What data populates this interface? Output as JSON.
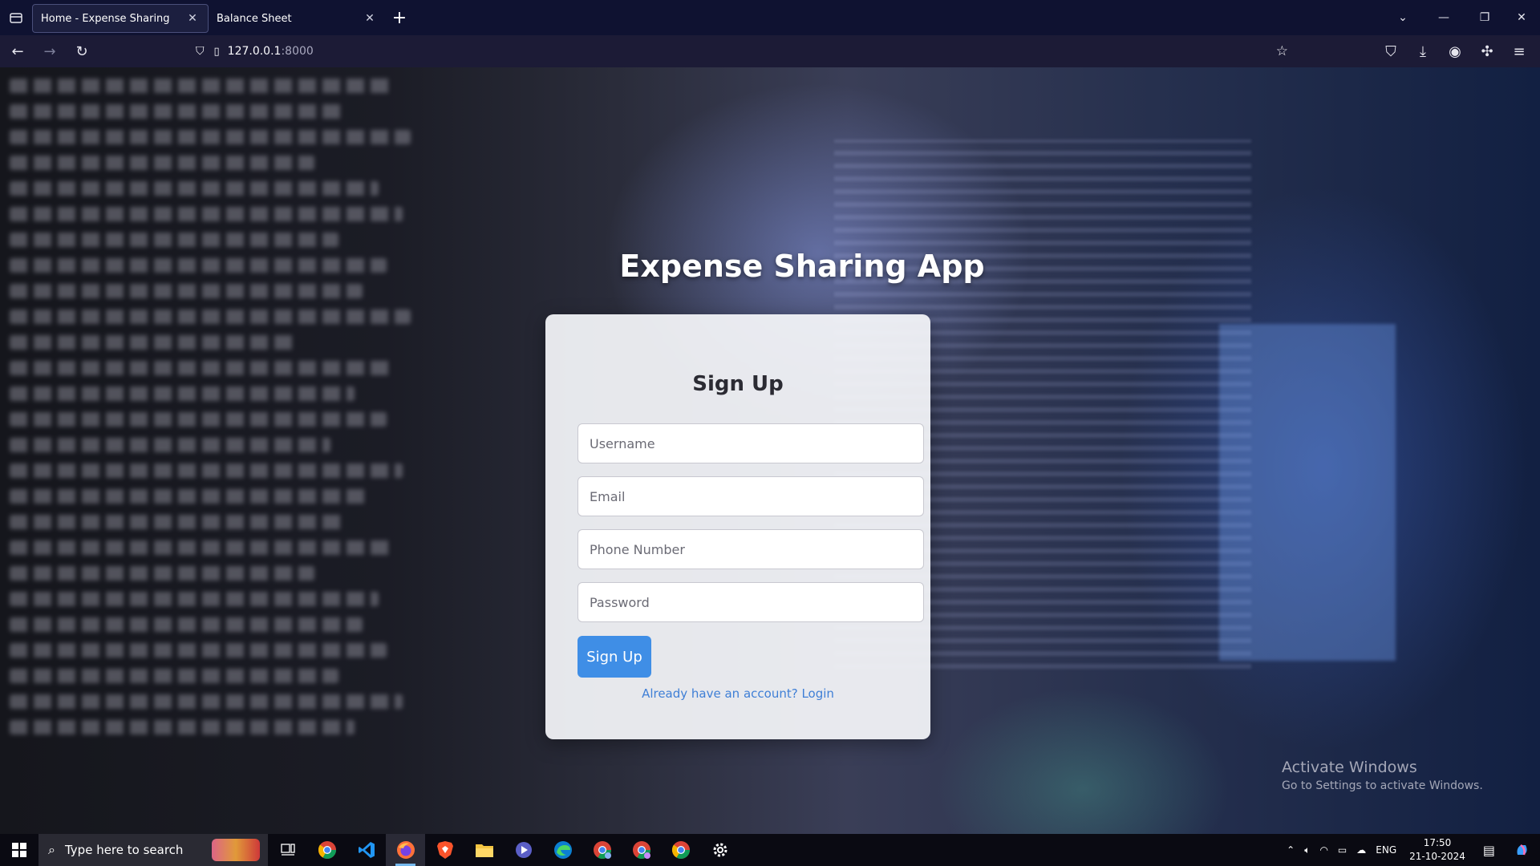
{
  "browser": {
    "tabs": [
      {
        "title": "Home - Expense Sharing",
        "active": true
      },
      {
        "title": "Balance Sheet",
        "active": false
      }
    ],
    "url_host": "127.0.0.1",
    "url_port": ":8000"
  },
  "page": {
    "app_title": "Expense Sharing App",
    "form": {
      "title": "Sign Up",
      "username_placeholder": "Username",
      "email_placeholder": "Email",
      "phone_placeholder": "Phone Number",
      "password_placeholder": "Password",
      "submit_label": "Sign Up",
      "login_link": "Already have an account? Login"
    }
  },
  "watermark": {
    "title": "Activate Windows",
    "subtitle": "Go to Settings to activate Windows."
  },
  "taskbar": {
    "search_placeholder": "Type here to search",
    "apps": [
      "task-view-icon",
      "chrome-icon",
      "vscode-icon",
      "firefox-icon",
      "brave-icon",
      "file-explorer-icon",
      "media-player-icon",
      "edge-icon",
      "chrome-profile-icon",
      "chrome-profile-2-icon",
      "chrome-profile-3-icon",
      "settings-icon"
    ],
    "language": "ENG",
    "time": "17:50",
    "date": "21-10-2024"
  },
  "colors": {
    "accent": "#3f8ee6",
    "link": "#3f7fd6",
    "tab_bar": "#0f1231",
    "nav_bar": "#1c1b36"
  }
}
